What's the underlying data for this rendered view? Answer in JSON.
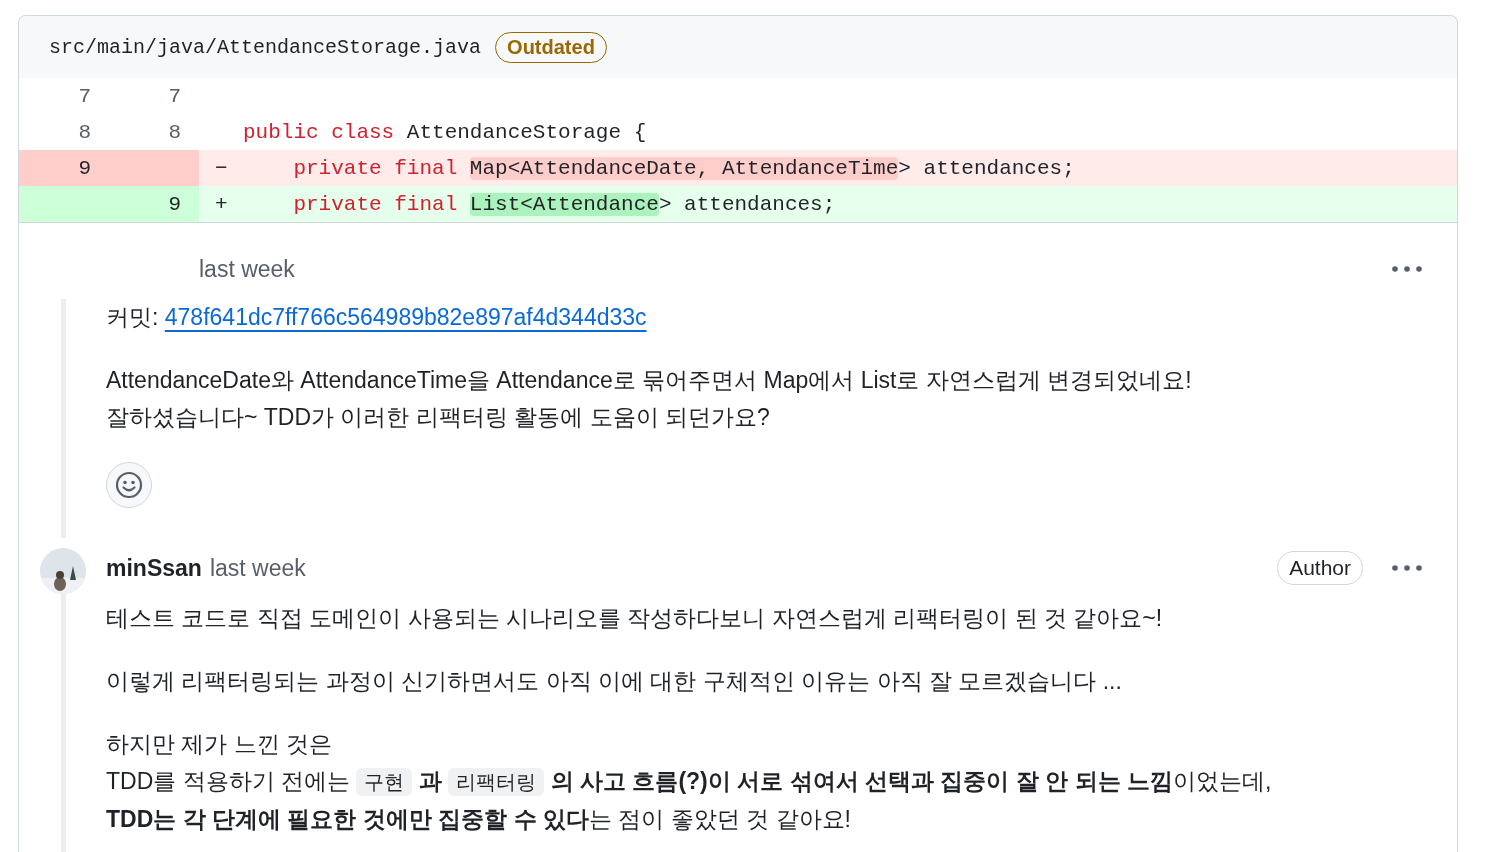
{
  "file": {
    "path": "src/main/java/AttendanceStorage.java",
    "badge": "Outdated"
  },
  "diff": [
    {
      "kind": "context",
      "old": "7",
      "new": "7"
    },
    {
      "kind": "context",
      "old": "8",
      "new": "8",
      "tokens": [
        {
          "kind": "keyword",
          "text": "public class "
        },
        {
          "kind": "plain",
          "text": "AttendanceStorage {"
        }
      ]
    },
    {
      "kind": "del",
      "old": "9",
      "sign": "−",
      "tokens": [
        {
          "kind": "keyword",
          "text": "    private final "
        },
        {
          "kind": "highlight",
          "text": "Map<AttendanceDate, AttendanceTime"
        },
        {
          "kind": "plain",
          "text": "> attendances;"
        }
      ]
    },
    {
      "kind": "add",
      "new": "9",
      "sign": "+",
      "tokens": [
        {
          "kind": "keyword",
          "text": "    private final "
        },
        {
          "kind": "highlight",
          "text": "List<Attendance"
        },
        {
          "kind": "plain",
          "text": "> attendances;"
        }
      ]
    }
  ],
  "comments": [
    {
      "time": "last week",
      "paragraphs": [
        [
          [
            {
              "kind": "text",
              "text": "커밋: "
            },
            {
              "kind": "link",
              "text": "478f641dc7ff766c564989b82e897af4d344d33c"
            }
          ]
        ],
        [
          [
            {
              "kind": "text",
              "text": "AttendanceDate와 AttendanceTime을 Attendance로 묶어주면서 Map에서 List로 자연스럽게 변경되었네요!"
            }
          ],
          [
            {
              "kind": "text",
              "text": "잘하셨습니다~ TDD가 이러한 리팩터링 활동에 도움이 되던가요?"
            }
          ]
        ]
      ],
      "reactions": true
    },
    {
      "author": "minSsan",
      "time": "last week",
      "badge": "Author",
      "paragraphs": [
        [
          [
            {
              "kind": "text",
              "text": "테스트 코드로 직접 도메인이 사용되는 시나리오를 작성하다보니 자연스럽게 리팩터링이 된 것 같아요~!"
            }
          ]
        ],
        [
          [
            {
              "kind": "text",
              "text": "이렇게 리팩터링되는 과정이 신기하면서도 아직 이에 대한 구체적인 이유는 아직 잘 모르겠습니다 ..."
            }
          ]
        ],
        [
          [
            {
              "kind": "text",
              "text": "하지만 제가 느낀 것은"
            }
          ],
          [
            {
              "kind": "text",
              "text": "TDD를 적용하기 전에는 "
            },
            {
              "kind": "code",
              "text": "구현"
            },
            {
              "kind": "text",
              "text": " **과** "
            },
            {
              "kind": "code",
              "text": "리팩터링"
            },
            {
              "kind": "text",
              "text": " **의 사고 흐름(?)이 서로 섞여서 선택과 집중이 잘 안 되는 느낌**이었는데,"
            }
          ],
          [
            {
              "kind": "text",
              "text": "**TDD는 각 단계에 필요한 것에만 집중할 수 있다**는 점이 좋았던 것 같아요!"
            }
          ]
        ]
      ],
      "reactions": false
    }
  ]
}
